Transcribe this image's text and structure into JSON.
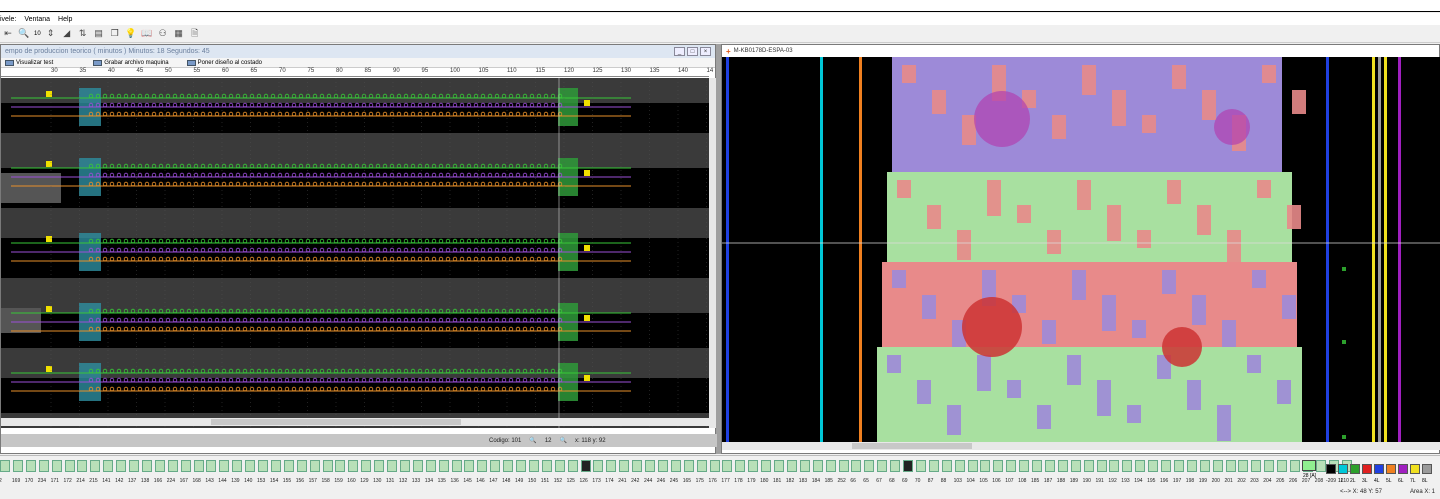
{
  "menu": {
    "items": [
      "ivele:",
      "Ventana",
      "Help"
    ]
  },
  "toolbar": {
    "zoom_value": "10"
  },
  "left_window": {
    "title": "empo de produccion teorico ( minutos ) Minutos: 18 Segundos: 45",
    "tools": {
      "visualizar_test": "Visualizar test",
      "grabar": "Grabar archivo maquina",
      "poner": "Poner diseño al costado"
    },
    "ruler_ticks": [
      "30",
      "35",
      "40",
      "45",
      "50",
      "55",
      "60",
      "65",
      "70",
      "75",
      "80",
      "85",
      "90",
      "95",
      "100",
      "105",
      "110",
      "115",
      "120",
      "125",
      "130",
      "135",
      "140",
      "14"
    ],
    "status": {
      "codigo": "Codigo: 101",
      "zoom": "12",
      "xy": "x: 118 y: 92"
    }
  },
  "right_window": {
    "title": "M-KB0178D-ESPA-03"
  },
  "bottom": {
    "codes": [
      "2",
      "169",
      "170",
      "234",
      "171",
      "172",
      "214",
      "215",
      "141",
      "142",
      "137",
      "138",
      "166",
      "224",
      "167",
      "168",
      "143",
      "144",
      "139",
      "140",
      "153",
      "154",
      "155",
      "156",
      "157",
      "158",
      "159",
      "160",
      "129",
      "130",
      "131",
      "132",
      "133",
      "134",
      "135",
      "136",
      "145",
      "146",
      "147",
      "148",
      "149",
      "150",
      "151",
      "152",
      "125",
      "126",
      "173",
      "174",
      "241",
      "242",
      "244",
      "246",
      "245",
      "165",
      "175",
      "176",
      "177",
      "178",
      "179",
      "180",
      "181",
      "182",
      "183",
      "184",
      "185",
      "252",
      "66",
      "65",
      "67",
      "68",
      "69",
      "70",
      "87",
      "88",
      "103",
      "104",
      "105",
      "106",
      "107",
      "108",
      "185",
      "187",
      "188",
      "189",
      "190",
      "191",
      "192",
      "193",
      "194",
      "195",
      "196",
      "197",
      "198",
      "199",
      "200",
      "201",
      "202",
      "203",
      "204",
      "205",
      "206",
      "207",
      "208",
      "209",
      "210"
    ],
    "selected_label": "28",
    "selected_sub": "[A]",
    "palette_labels": [
      "-",
      "1L",
      "2L",
      "3L",
      "4L",
      "5L",
      "6L",
      "7L",
      "8L"
    ],
    "palette_colors": [
      "#000000",
      "#00c8d8",
      "#2ca02c",
      "#e02020",
      "#2040e0",
      "#f08020",
      "#a020c0",
      "#f0e020",
      "#9a9a9a"
    ],
    "coords": "<--> X: 48  Y: 57",
    "area": "Area X: 1"
  }
}
